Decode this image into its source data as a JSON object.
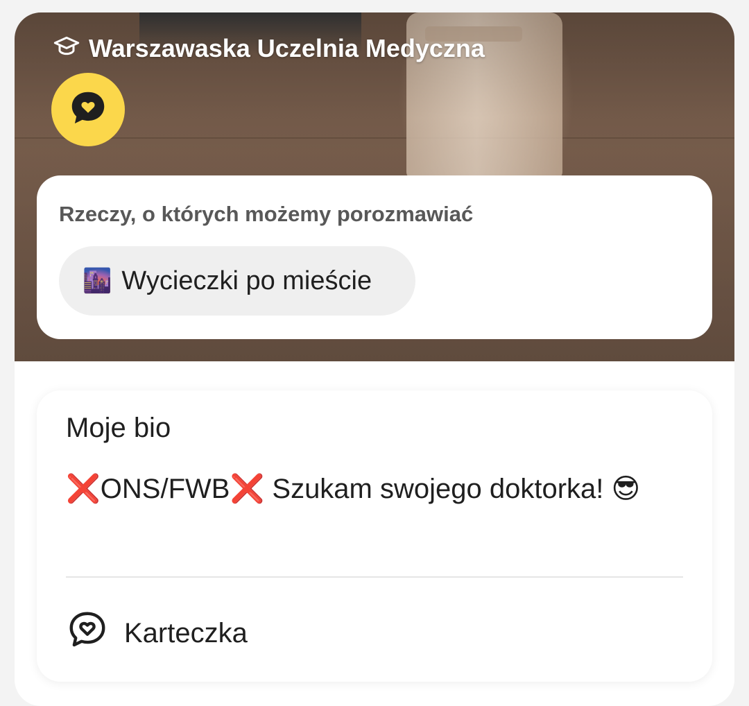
{
  "profile": {
    "school": "Warszawaska Uczelnia Medyczna",
    "school_icon": "graduation-cap-icon",
    "badge_icon": "chat-heart-icon",
    "badge_color": "#fbd74b"
  },
  "topics": {
    "title": "Rzeczy, o których możemy porozmawiać",
    "items": [
      {
        "emoji": "🌆",
        "label": "Wycieczki po mieście"
      }
    ]
  },
  "bio": {
    "title": "Moje bio",
    "text": "❌ONS/FWB❌ Szukam swojego doktorka! 😎",
    "note_icon": "chat-heart-icon",
    "note_label": "Karteczka"
  }
}
